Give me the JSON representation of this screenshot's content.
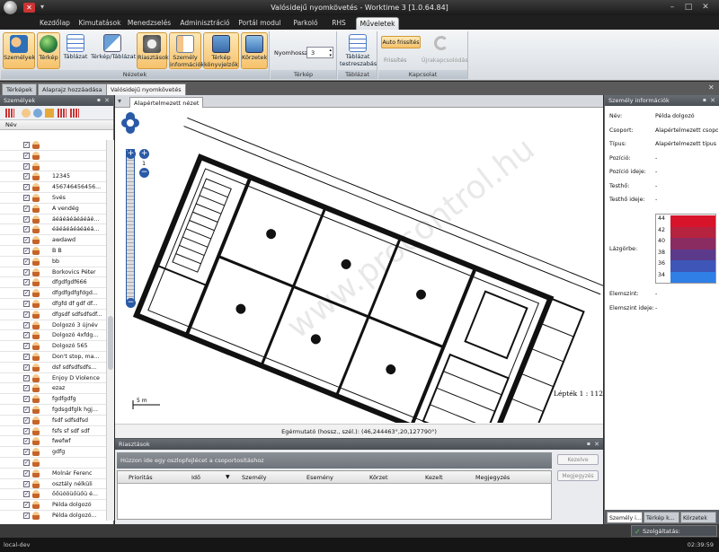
{
  "window": {
    "title": "Valósidejű nyomkövetés - Worktime 3 [1.0.64.84]"
  },
  "ribbon_tabs": [
    "Kezdőlap",
    "Kimutatások",
    "Menedzselés",
    "Adminisztráció",
    "Portál modul",
    "Parkoló",
    "RHS",
    "Műveletek"
  ],
  "ribbon": {
    "groups": {
      "nezetek": "Nézetek",
      "terkep": "Térkép",
      "tablazat": "Táblázat",
      "kapcsolat": "Kapcsolat"
    },
    "buttons": {
      "szemelyek": "Személyek",
      "terkep": "Térkép",
      "tablazat": "Táblázat",
      "terkep_tablazat": "Térkép/Táblázat",
      "riasztasok": "Riasztások",
      "szemely_info_1": "Személy",
      "szemely_info_2": "információk",
      "terkep_konyv_1": "Térkép",
      "terkep_konyv_2": "könyvjelzők",
      "korzetek": "Körzetek",
      "nyomhossz_label": "Nyomhossz",
      "nyomhossz_value": "3",
      "tablazat_testreszabas_1": "Táblázat",
      "tablazat_testreszabas_2": "testreszabás",
      "auto_frissites": "Auto frissítés",
      "frissites": "Frissítés",
      "ujrakapcsolodas": "Újrakapcsolódás"
    }
  },
  "doc_tabs": [
    "Térképek",
    "Alaprajz hozzáadása",
    "Valósidejű nyomkövetés"
  ],
  "left_panel": {
    "title": "Személyek",
    "column": "Név",
    "names": [
      "",
      "",
      "",
      "12345",
      "456746456456...",
      "Svés",
      "A vendég",
      "áéáéáéáéáéáé...",
      "éáéáéáéáéáéá...",
      "awdawd",
      "B B",
      "bb",
      "Borkovics Péter",
      "dfgdfgdf666",
      "dfgdfgdfgfdgd...",
      "dfgfd df gdf df...",
      "dfgsdf sdfsdfsdf...",
      "Dolgozó 3 újnév",
      "Dolgozó 4xfdg...",
      "Dolgozó 565",
      "Don't stop, ma...",
      "dsf sdfsdfsdfs...",
      "Enjoy D Violence",
      "ezaz",
      "fgdfgdfg",
      "fgdsgdfglk hgj...",
      "fsdf sdfsdfsd",
      "fsfs sf sdf sdf",
      "fwefwf",
      "gdfg",
      "",
      "Molnár Ferenc",
      "osztály nélküli",
      "őőüóöüőüőü é...",
      "Példa dolgozó",
      "Példa dolgozó..."
    ]
  },
  "center": {
    "tab": "Alapértelmezett nézet",
    "scale_label": "5 m",
    "scale_ratio": "Lépték 1 : 112",
    "zoom_level": "1",
    "watermark": "www.procontrol.hu",
    "cursor_text": "Egérmutató (hossz., szél.):  (46,244463°,20,127790°)"
  },
  "alarm": {
    "title": "Riasztások",
    "group_hint": "Húzzon ide egy oszlopfejlécet a csoportosításhoz",
    "columns": [
      "Prioritás",
      "Idő",
      "Személy",
      "Esemény",
      "Körzet",
      "Kezelt",
      "Megjegyzés"
    ],
    "btn_kezeles": "Kezelve",
    "btn_megjegyzes": "Megjegyzés"
  },
  "right_panel": {
    "title": "Személy információk",
    "props": [
      {
        "k": "Név:",
        "v": "Példa dolgozó"
      },
      {
        "k": "Csoport:",
        "v": "Alapértelmezett csoport"
      },
      {
        "k": "Típus:",
        "v": "Alapértelmezett típus"
      },
      {
        "k": "Pozíció:",
        "v": "-"
      },
      {
        "k": "Pozíció ideje:",
        "v": "-"
      },
      {
        "k": "Testhő:",
        "v": "-"
      },
      {
        "k": "Testhő ideje:",
        "v": "-"
      }
    ],
    "lazgorbe_label": "Lázgörbe:",
    "legend": [
      "44",
      "42",
      "40",
      "38",
      "36",
      "34"
    ],
    "elemszint_label": "Elemszint:",
    "elemszint_val": "-",
    "elemszint_ideje_label": "Elemszint ideje:",
    "elemszint_ideje_val": "-",
    "tabs": [
      "Személy i...",
      "Térkép k...",
      "Körzetek"
    ]
  },
  "status": {
    "service": "Szolgáltatás: kapcsolódva",
    "host": "local-dev",
    "clock": "02:39:59"
  },
  "colors": {
    "highlight": "#f6c26b",
    "accent": "#3a76c4"
  }
}
